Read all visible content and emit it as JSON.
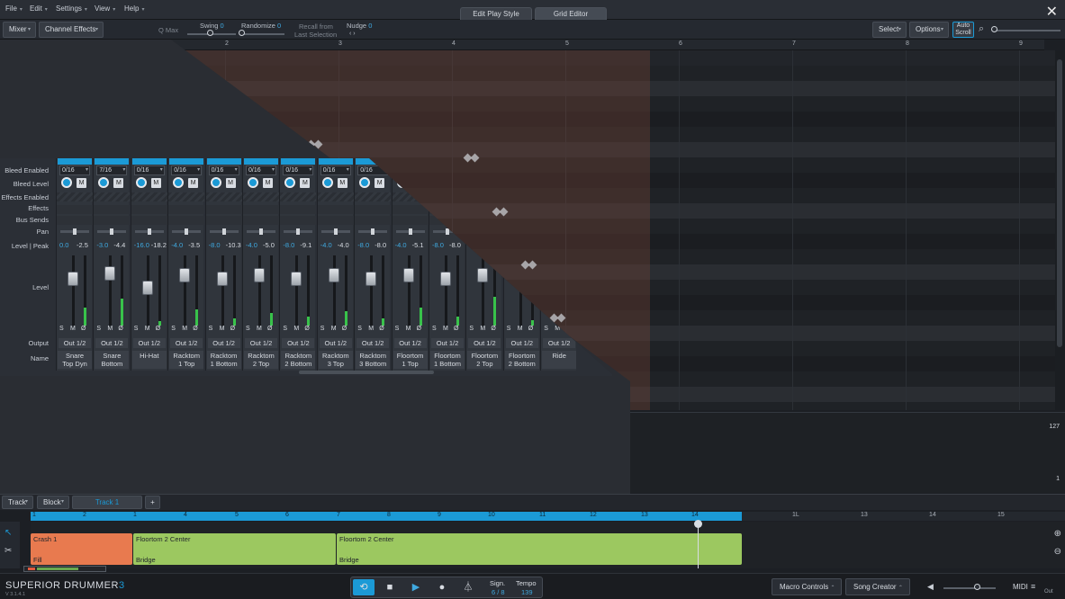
{
  "menu": {
    "items": [
      "File",
      "Edit",
      "Settings",
      "View",
      "Help"
    ],
    "tabs": [
      "Edit Play Style",
      "Grid Editor"
    ]
  },
  "toolbar": {
    "mixer_label": "Mixer",
    "channel_effects_label": "Channel Effects",
    "qmax_label": "Q Max",
    "swing_label": "Swing",
    "swing_value": "0",
    "randomize_label": "Randomize",
    "randomize_value": "0",
    "recall_line1": "Recall from",
    "recall_line2": "Last Selection",
    "nudge_label": "Nudge",
    "nudge_value": "0",
    "select_label": "Select",
    "options_label": "Options",
    "autoscroll_line1": "Auto",
    "autoscroll_line2": "Scroll"
  },
  "ruler": [
    "2",
    "3",
    "4",
    "5",
    "6",
    "7",
    "8",
    "9"
  ],
  "velocity": {
    "max": "127",
    "min": "1"
  },
  "mixer": {
    "row_labels": {
      "bleed_enabled": "Bleed Enabled",
      "bleed_level": "Bleed Level",
      "effects_enabled": "Effects Enabled",
      "effects": "Effects",
      "bus_sends": "Bus Sends",
      "pan": "Pan",
      "level_peak": "Level | Peak",
      "level": "Level",
      "output": "Output",
      "name": "Name"
    },
    "channels": [
      {
        "bleed": "0/16",
        "level": "0.0",
        "peak": "-2.5",
        "output": "Out 1/2",
        "name1": "Snare",
        "name2": "Top Dyn"
      },
      {
        "bleed": "7/16",
        "level": "-3.0",
        "peak": "-4.4",
        "output": "Out 1/2",
        "name1": "Snare",
        "name2": "Bottom"
      },
      {
        "bleed": "0/16",
        "level": "-16.0",
        "peak": "-18.2",
        "output": "Out 1/2",
        "name1": "Hi-Hat",
        "name2": ""
      },
      {
        "bleed": "0/16",
        "level": "-4.0",
        "peak": "-3.5",
        "output": "Out 1/2",
        "name1": "Racktom",
        "name2": "1 Top"
      },
      {
        "bleed": "0/16",
        "level": "-8.0",
        "peak": "-10.3",
        "output": "Out 1/2",
        "name1": "Racktom",
        "name2": "1 Bottom"
      },
      {
        "bleed": "0/16",
        "level": "-4.0",
        "peak": "-5.0",
        "output": "Out 1/2",
        "name1": "Racktom",
        "name2": "2 Top"
      },
      {
        "bleed": "0/16",
        "level": "-8.0",
        "peak": "-9.1",
        "output": "Out 1/2",
        "name1": "Racktom",
        "name2": "2 Bottom"
      },
      {
        "bleed": "0/16",
        "level": "-4.0",
        "peak": "-4.0",
        "output": "Out 1/2",
        "name1": "Racktom",
        "name2": "3 Top"
      },
      {
        "bleed": "0/16",
        "level": "-8.0",
        "peak": "-8.0",
        "output": "Out 1/2",
        "name1": "Racktom",
        "name2": "3 Bottom"
      },
      {
        "bleed": "0/16",
        "level": "-4.0",
        "peak": "-5.1",
        "output": "Out 1/2",
        "name1": "Floortom",
        "name2": "1 Top"
      },
      {
        "bleed": "0/16",
        "level": "-8.0",
        "peak": "-8.0",
        "output": "Out 1/2",
        "name1": "Floortom",
        "name2": "1 Bottom"
      },
      {
        "bleed": "0/16",
        "level": "-4.0",
        "peak": "-4.0",
        "output": "Out 1/2",
        "name1": "Floortom",
        "name2": "2 Top"
      },
      {
        "bleed": "0/16",
        "level": "-8.0",
        "peak": "-8.0",
        "output": "Out 1/2",
        "name1": "Floortom",
        "name2": "2 Bottom"
      },
      {
        "bleed": "0/16",
        "level": "-4.0",
        "peak": "-4.0",
        "output": "Out 1/2",
        "name1": "Ride",
        "name2": ""
      }
    ],
    "smb": [
      "S",
      "M",
      "Ø"
    ],
    "mute_label": "M"
  },
  "track": {
    "track_label": "Track",
    "block_label": "Block",
    "tab_label": "Track 1",
    "add_label": "+",
    "song_ruler": [
      "1",
      "2",
      "1",
      "4",
      "5",
      "6",
      "7",
      "8",
      "9",
      "10",
      "11",
      "12",
      "13",
      "14",
      "15"
    ],
    "song_ruler_off": [
      "1L",
      "13",
      "14",
      "15"
    ],
    "blocks": [
      {
        "title": "Crash 1",
        "sub": "Fill",
        "color": "#e87a4f"
      },
      {
        "title": "Floortom 2 Center",
        "sub": "Bridge",
        "color": "#9cc860"
      },
      {
        "title": "Floortom 2 Center",
        "sub": "Bridge",
        "color": "#9cc860"
      }
    ]
  },
  "transport": {
    "logo_a": "SUPERIOR DRUMMER",
    "logo_b": "3",
    "version": "V 3.1.4.1",
    "sign_label": "Sign.",
    "sign_value": "6 / 8",
    "tempo_label": "Tempo",
    "tempo_value": "139",
    "macro_label": "Macro Controls",
    "song_creator_label": "Song Creator",
    "midi_label": "MIDI",
    "out_label": "Out"
  },
  "colors": {
    "accent": "#1b9ad6",
    "fill_block": "#e87a4f",
    "bridge_block": "#9cc860",
    "meter": "#38c24a"
  }
}
